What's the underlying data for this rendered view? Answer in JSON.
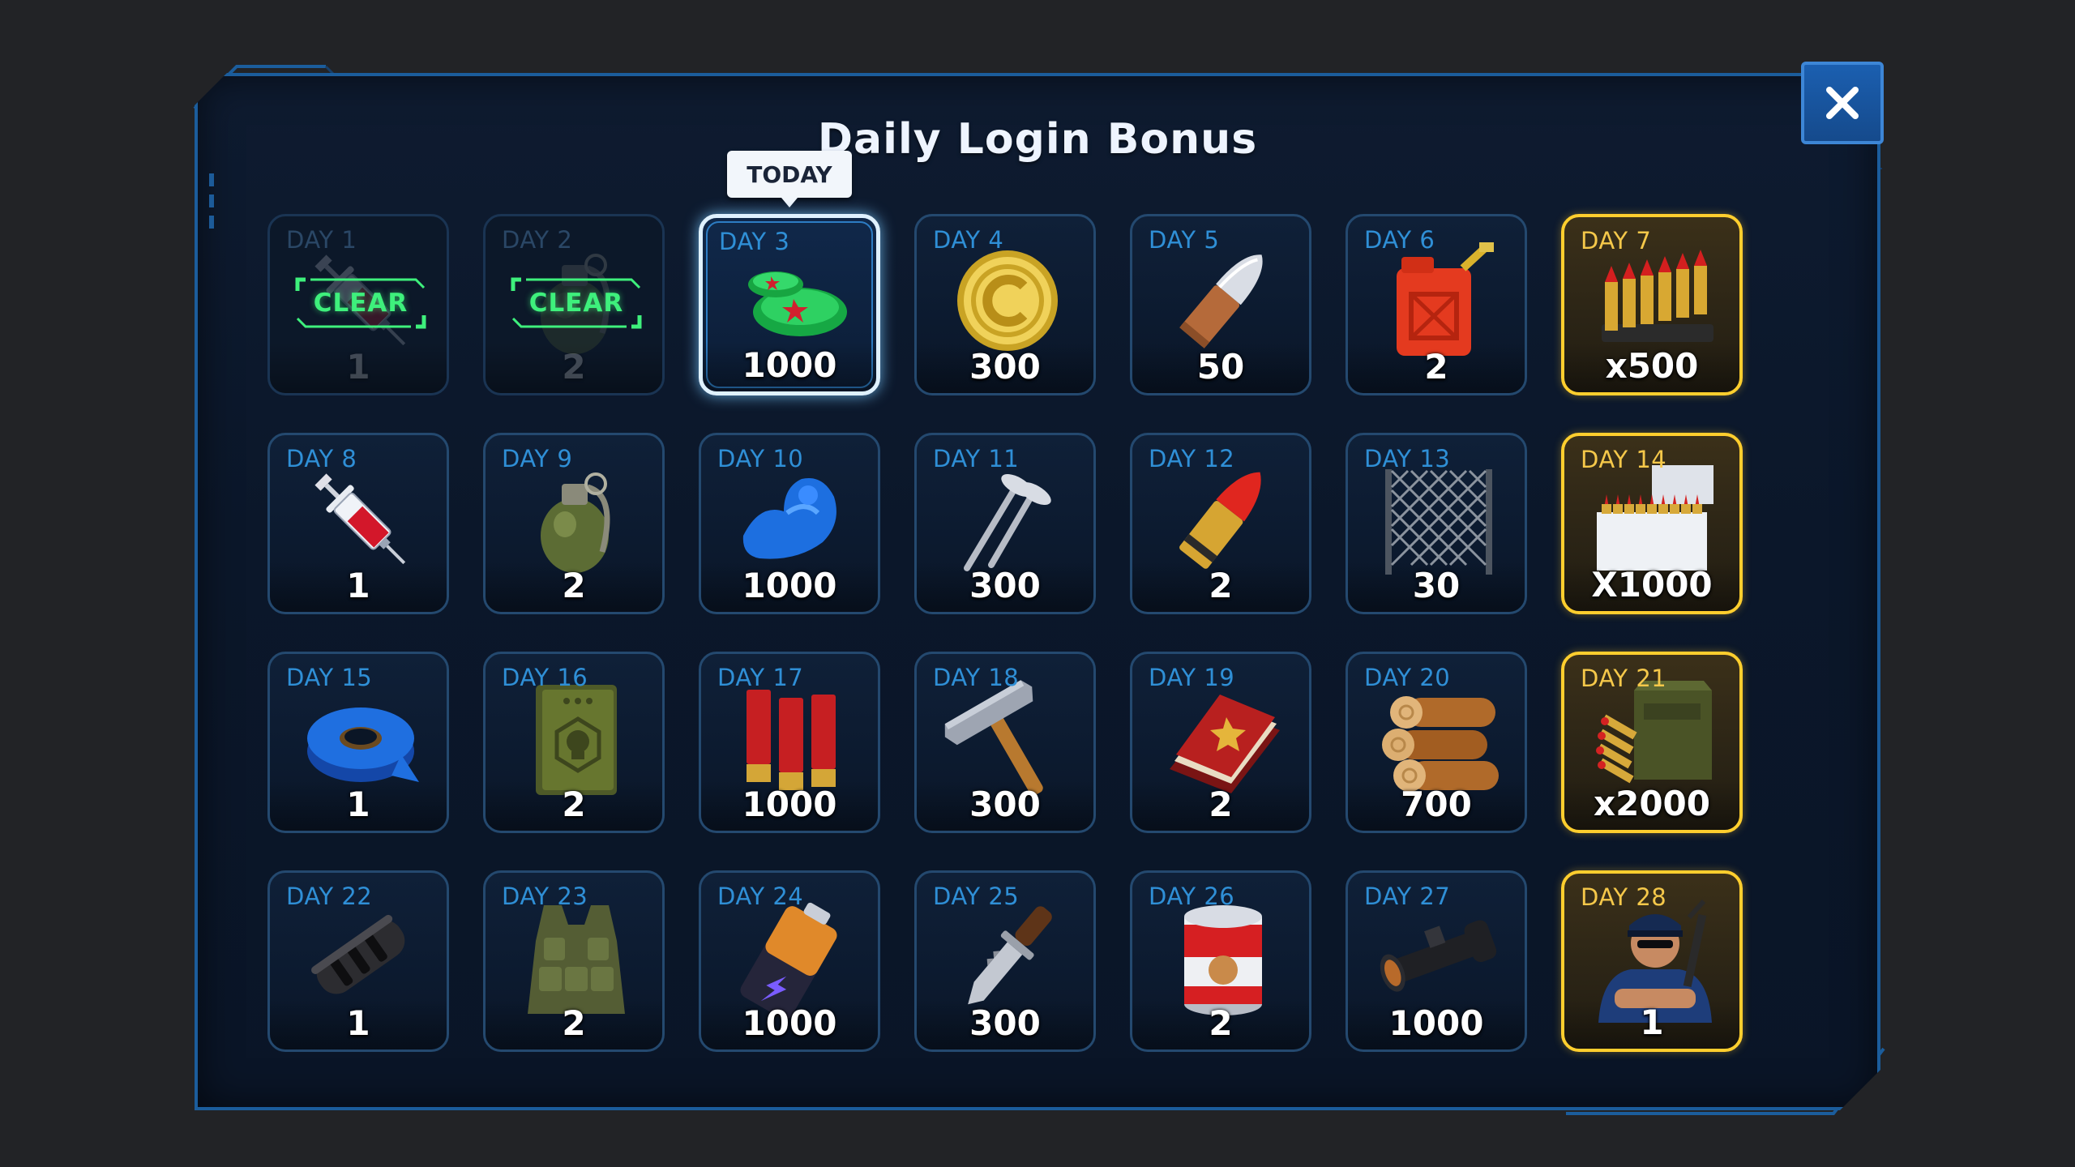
{
  "title": "Daily Login Bonus",
  "today_label": "TODAY",
  "claimed_label": "CLEAR",
  "close_icon": "close-icon",
  "colors": {
    "background": "#222326",
    "panel": "#0d1a2e",
    "panel_border": "#1b5d9c",
    "day_label": "#2f8fd6",
    "premium_border": "#ffce2e",
    "claimed_stamp": "#3ef07c",
    "close_button": "#1b5fb0"
  },
  "days": [
    {
      "day": "DAY 1",
      "qty": "1",
      "icon": "syringe-icon",
      "state": "claimed"
    },
    {
      "day": "DAY 2",
      "qty": "2",
      "icon": "grenade-icon",
      "state": "claimed"
    },
    {
      "day": "DAY 3",
      "qty": "1000",
      "icon": "bottle-caps-icon",
      "state": "today"
    },
    {
      "day": "DAY 4",
      "qty": "300",
      "icon": "gold-coin-icon",
      "state": "normal"
    },
    {
      "day": "DAY 5",
      "qty": "50",
      "icon": "bullet-icon",
      "state": "normal"
    },
    {
      "day": "DAY 6",
      "qty": "2",
      "icon": "fuel-canister-icon",
      "state": "normal"
    },
    {
      "day": "DAY 7",
      "qty": "x500",
      "icon": "ammo-strip-icon",
      "state": "premium"
    },
    {
      "day": "DAY 8",
      "qty": "1",
      "icon": "syringe-icon",
      "state": "normal"
    },
    {
      "day": "DAY 9",
      "qty": "2",
      "icon": "grenade-icon",
      "state": "normal"
    },
    {
      "day": "DAY 10",
      "qty": "1000",
      "icon": "flexed-arm-icon",
      "state": "normal"
    },
    {
      "day": "DAY 11",
      "qty": "300",
      "icon": "nails-icon",
      "state": "normal"
    },
    {
      "day": "DAY 12",
      "qty": "2",
      "icon": "red-tip-bullet-icon",
      "state": "normal"
    },
    {
      "day": "DAY 13",
      "qty": "30",
      "icon": "fence-net-icon",
      "state": "normal"
    },
    {
      "day": "DAY 14",
      "qty": "X1000",
      "icon": "ammo-box-icon",
      "state": "premium"
    },
    {
      "day": "DAY 15",
      "qty": "1",
      "icon": "tape-roll-icon",
      "state": "normal"
    },
    {
      "day": "DAY 16",
      "qty": "2",
      "icon": "skull-book-icon",
      "state": "normal"
    },
    {
      "day": "DAY 17",
      "qty": "1000",
      "icon": "shotgun-shells-icon",
      "state": "normal"
    },
    {
      "day": "DAY 18",
      "qty": "300",
      "icon": "hammer-icon",
      "state": "normal"
    },
    {
      "day": "DAY 19",
      "qty": "2",
      "icon": "red-book-icon",
      "state": "normal"
    },
    {
      "day": "DAY 20",
      "qty": "700",
      "icon": "wood-logs-icon",
      "state": "normal"
    },
    {
      "day": "DAY 21",
      "qty": "x2000",
      "icon": "ammo-crate-icon",
      "state": "premium"
    },
    {
      "day": "DAY 22",
      "qty": "1",
      "icon": "muzzle-brake-icon",
      "state": "normal"
    },
    {
      "day": "DAY 23",
      "qty": "2",
      "icon": "tactical-vest-icon",
      "state": "normal"
    },
    {
      "day": "DAY 24",
      "qty": "1000",
      "icon": "battery-icon",
      "state": "normal"
    },
    {
      "day": "DAY 25",
      "qty": "300",
      "icon": "combat-knife-icon",
      "state": "normal"
    },
    {
      "day": "DAY 26",
      "qty": "2",
      "icon": "canned-food-icon",
      "state": "normal"
    },
    {
      "day": "DAY 27",
      "qty": "1000",
      "icon": "rifle-scope-icon",
      "state": "normal"
    },
    {
      "day": "DAY 28",
      "qty": "1",
      "icon": "police-officer-icon",
      "state": "premium"
    }
  ]
}
